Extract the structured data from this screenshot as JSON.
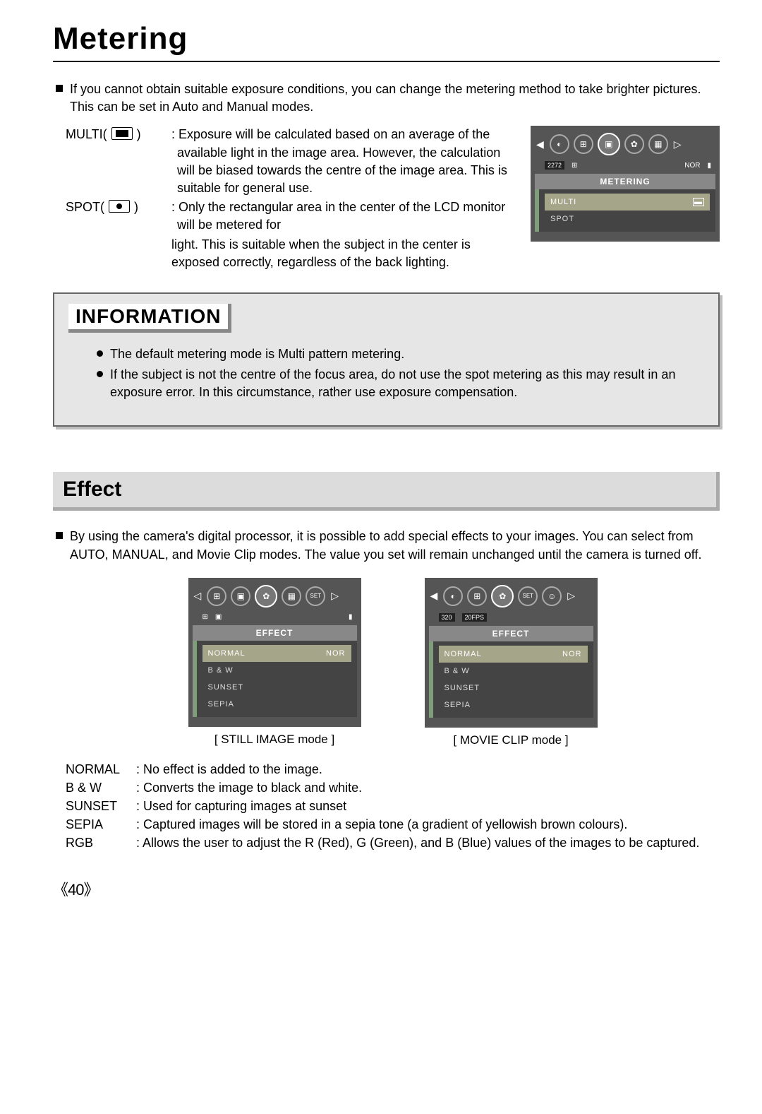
{
  "page_number": "《40》",
  "title": "Metering",
  "intro": "If you cannot obtain suitable exposure conditions, you can change the metering method to take brighter pictures. This can be set in Auto and Manual modes.",
  "metering_defs": {
    "multi": {
      "label": "MULTI(",
      "label_close": ")",
      "text1": "Exposure will be calculated based on an average of the available light in the image area. However, the calculation will be biased towards the centre of the image area. This is suitable for general use."
    },
    "spot": {
      "label": "SPOT(",
      "label_close": ")",
      "text1": "Only the rectangular area in the center of the LCD monitor will be metered for",
      "text2": "light. This is suitable when the subject in the center is exposed correctly, regardless of the back lighting."
    }
  },
  "cam_metering": {
    "status_res": "2272",
    "status_nor": "NOR",
    "title": "METERING",
    "items": [
      "MULTI",
      "SPOT"
    ]
  },
  "info_box": {
    "title": "INFORMATION",
    "items": [
      "The default metering mode is Multi pattern metering.",
      "If the subject is not the centre of the focus area, do not use the spot metering as this may result in an exposure error. In this circumstance, rather use exposure compensation."
    ]
  },
  "effect": {
    "title": "Effect",
    "intro": "By using the camera's digital processor, it is possible to add special effects to your images. You can select from AUTO, MANUAL, and Movie Clip modes. The value you set will remain unchanged until the camera is turned off.",
    "still_caption": "[ STILL IMAGE mode ]",
    "movie_caption": "[ MOVIE CLIP mode ]",
    "menu_title": "EFFECT",
    "menu_items": [
      "NORMAL",
      "B & W",
      "SUNSET",
      "SEPIA"
    ],
    "menu_right": "NOR",
    "movie_status_res": "320",
    "movie_status_fps": "20FPS",
    "defs": [
      {
        "label": "NORMAL",
        "text": ": No effect is added to the image."
      },
      {
        "label": "B & W",
        "text": ": Converts the image to black and white."
      },
      {
        "label": "SUNSET",
        "text": ": Used for capturing images at sunset"
      },
      {
        "label": "SEPIA",
        "text": ": Captured images will be stored in a sepia tone (a gradient of yellowish brown colours)."
      },
      {
        "label": "RGB",
        "text": ": Allows the user to adjust the R (Red), G (Green), and B (Blue) values of the images to be captured."
      }
    ]
  }
}
